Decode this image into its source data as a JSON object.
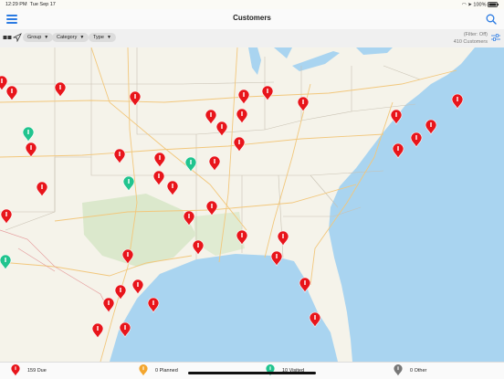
{
  "status_bar": {
    "time": "12:29 PM",
    "date": "Tue Sep 17",
    "battery": "100%"
  },
  "nav": {
    "title": "Customers",
    "menu_icon": "hamburger-icon",
    "search_icon": "search-icon"
  },
  "filters": {
    "chips": [
      {
        "label": "Group",
        "name": "group"
      },
      {
        "label": "Category",
        "name": "category"
      },
      {
        "label": "Type",
        "name": "type"
      }
    ],
    "status_line": "(Filter: Off)",
    "count_line": "410 Customers"
  },
  "colors": {
    "due": "#e8151b",
    "planned": "#f3a62e",
    "visited": "#21c48e",
    "other": "#777777",
    "accent": "#2a7ae2"
  },
  "legend": [
    {
      "label": "159 Due",
      "color": "#e8151b"
    },
    {
      "label": "0 Planned",
      "color": "#f3a62e"
    },
    {
      "label": "10 Visited",
      "color": "#21c48e"
    },
    {
      "label": "0 Other",
      "color": "#777777"
    }
  ],
  "map": {
    "markers": [
      {
        "status": "due"
      },
      {
        "status": "due"
      },
      {
        "status": "due"
      },
      {
        "status": "due"
      },
      {
        "status": "due"
      },
      {
        "status": "due"
      },
      {
        "status": "due"
      },
      {
        "status": "due"
      },
      {
        "status": "due"
      },
      {
        "status": "due"
      },
      {
        "status": "due"
      },
      {
        "status": "due"
      },
      {
        "status": "due"
      },
      {
        "status": "due"
      },
      {
        "status": "due"
      },
      {
        "status": "due"
      },
      {
        "status": "due"
      },
      {
        "status": "due"
      },
      {
        "status": "due"
      },
      {
        "status": "due"
      },
      {
        "status": "due"
      },
      {
        "status": "due"
      },
      {
        "status": "due"
      },
      {
        "status": "due"
      },
      {
        "status": "due"
      },
      {
        "status": "due"
      },
      {
        "status": "due"
      },
      {
        "status": "due"
      },
      {
        "status": "due"
      },
      {
        "status": "due"
      },
      {
        "status": "due"
      },
      {
        "status": "due"
      },
      {
        "status": "due"
      },
      {
        "status": "due"
      },
      {
        "status": "due"
      },
      {
        "status": "due"
      },
      {
        "status": "due"
      },
      {
        "status": "due"
      },
      {
        "status": "due"
      },
      {
        "status": "visited"
      },
      {
        "status": "visited"
      },
      {
        "status": "visited"
      },
      {
        "status": "visited"
      }
    ]
  }
}
